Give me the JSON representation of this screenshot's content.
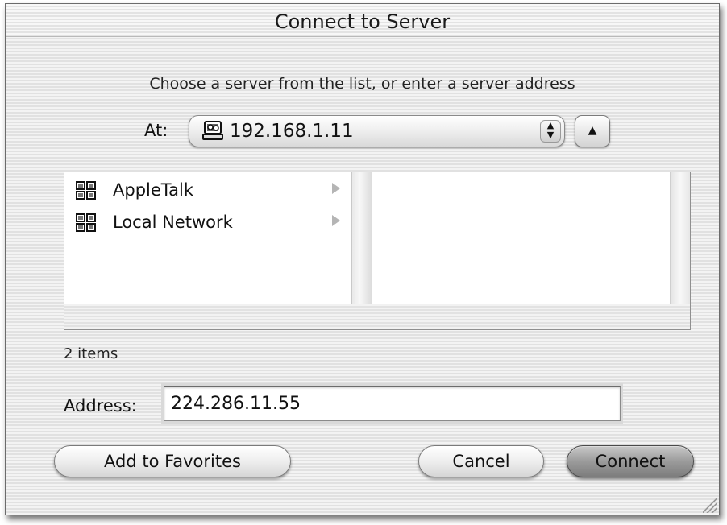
{
  "window": {
    "title": "Connect to Server"
  },
  "instruction": "Choose a server from the list, or enter a server address",
  "at": {
    "label": "At:",
    "value": "192.168.1.11",
    "icon": "server-icon"
  },
  "browser": {
    "items": [
      {
        "label": "AppleTalk",
        "icon": "network-icon"
      },
      {
        "label": "Local Network",
        "icon": "network-icon"
      }
    ]
  },
  "status": "2 items",
  "address": {
    "label": "Address:",
    "value": "224.286.11.55"
  },
  "buttons": {
    "add_to_favorites": "Add to Favorites",
    "cancel": "Cancel",
    "connect": "Connect"
  }
}
